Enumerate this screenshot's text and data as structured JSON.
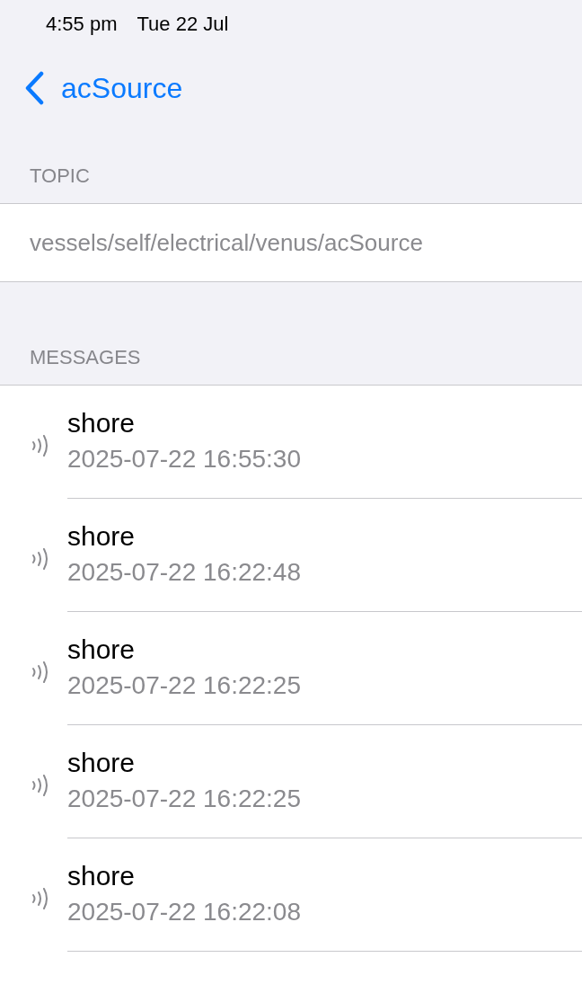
{
  "status_bar": {
    "time": "4:55 pm",
    "date": "Tue 22 Jul"
  },
  "nav": {
    "back_label": "acSource"
  },
  "topic": {
    "header": "TOPIC",
    "value": "vessels/self/electrical/venus/acSource"
  },
  "messages": {
    "header": "MESSAGES",
    "items": [
      {
        "title": "shore",
        "time": "2025-07-22 16:55:30"
      },
      {
        "title": "shore",
        "time": "2025-07-22 16:22:48"
      },
      {
        "title": "shore",
        "time": "2025-07-22 16:22:25"
      },
      {
        "title": "shore",
        "time": "2025-07-22 16:22:25"
      },
      {
        "title": "shore",
        "time": "2025-07-22 16:22:08"
      }
    ]
  }
}
